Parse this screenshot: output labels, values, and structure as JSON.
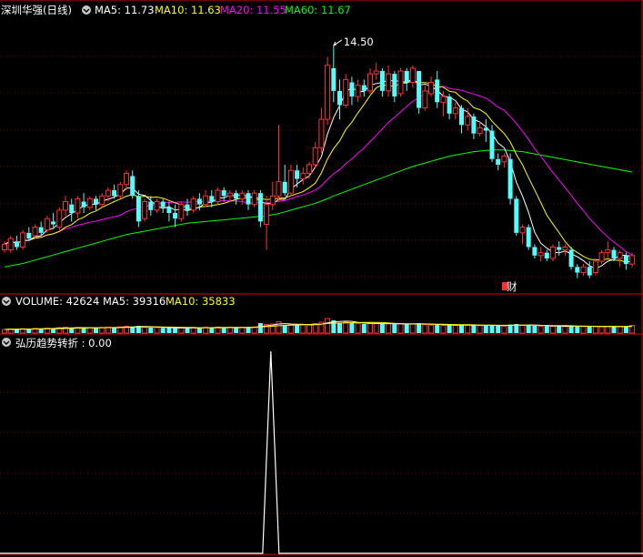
{
  "header": {
    "stock_title": "深圳华强(日线)",
    "ma_labels": [
      {
        "text": "MA5: 11.73",
        "color": "#ffffff"
      },
      {
        "text": "MA10: 11.63",
        "color": "#ffff00"
      },
      {
        "text": "MA20: 11.55",
        "color": "#ff00ff"
      },
      {
        "text": "MA60: 11.67",
        "color": "#00ff00"
      }
    ],
    "high_marker": "14.50",
    "finance_marker": "财"
  },
  "volume_header": [
    {
      "text": "VOLUME: 42624",
      "color": "#ffffff"
    },
    {
      "text": "MA5: 39316",
      "color": "#ffffff"
    },
    {
      "text": "MA10: 35833",
      "color": "#ffff00"
    }
  ],
  "indicator_header": {
    "text": "弘历趋势转折 : 0.00",
    "color": "#ffffff"
  },
  "colors": {
    "up": "#ff3232",
    "down": "#54ffff",
    "border": "#b00000",
    "grid": "#7a0000",
    "ma5": "#ffffff",
    "ma10": "#ffff00",
    "ma20": "#ff00ff",
    "ma60": "#00ff00"
  },
  "chart_data": {
    "type": "candlestick",
    "y_range": [
      10.3,
      14.9
    ],
    "max_price": 14.5,
    "candles": [
      [
        10.9,
        11.0,
        10.85,
        11.05
      ],
      [
        10.9,
        11.1,
        10.85,
        11.15
      ],
      [
        11.05,
        10.95,
        10.9,
        11.15
      ],
      [
        10.95,
        11.2,
        10.9,
        11.25
      ],
      [
        11.2,
        11.1,
        11.05,
        11.3
      ],
      [
        11.15,
        11.3,
        11.1,
        11.35
      ],
      [
        11.3,
        11.2,
        11.15,
        11.4
      ],
      [
        11.25,
        11.45,
        11.2,
        11.5
      ],
      [
        11.4,
        11.35,
        11.3,
        11.55
      ],
      [
        11.3,
        11.6,
        11.25,
        11.65
      ],
      [
        11.6,
        11.75,
        11.5,
        11.85
      ],
      [
        11.7,
        11.55,
        11.4,
        11.8
      ],
      [
        11.55,
        11.8,
        11.45,
        11.85
      ],
      [
        11.75,
        11.65,
        11.55,
        11.9
      ],
      [
        11.65,
        11.8,
        11.6,
        11.85
      ],
      [
        11.8,
        11.7,
        11.6,
        11.85
      ],
      [
        11.7,
        11.85,
        11.65,
        11.9
      ],
      [
        11.85,
        11.95,
        11.75,
        12.0
      ],
      [
        11.95,
        11.85,
        11.8,
        12.05
      ],
      [
        11.85,
        12.05,
        11.8,
        12.1
      ],
      [
        12.05,
        12.25,
        11.95,
        12.3
      ],
      [
        12.2,
        11.85,
        11.8,
        12.3
      ],
      [
        11.85,
        11.4,
        11.3,
        11.95
      ],
      [
        11.45,
        11.75,
        11.4,
        11.8
      ],
      [
        11.75,
        11.6,
        11.5,
        11.85
      ],
      [
        11.6,
        11.75,
        11.55,
        11.8
      ],
      [
        11.75,
        11.65,
        11.55,
        11.8
      ],
      [
        11.65,
        11.55,
        11.4,
        11.75
      ],
      [
        11.55,
        11.45,
        11.3,
        11.7
      ],
      [
        11.45,
        11.7,
        11.4,
        11.75
      ],
      [
        11.7,
        11.6,
        11.5,
        11.8
      ],
      [
        11.6,
        11.8,
        11.55,
        11.85
      ],
      [
        11.8,
        11.7,
        11.6,
        11.9
      ],
      [
        11.7,
        11.85,
        11.65,
        11.95
      ],
      [
        11.85,
        11.75,
        11.65,
        11.95
      ],
      [
        11.75,
        11.95,
        11.7,
        12.0
      ],
      [
        11.95,
        11.85,
        11.75,
        12.0
      ],
      [
        11.85,
        11.9,
        11.75,
        11.95
      ],
      [
        11.9,
        11.8,
        11.7,
        11.95
      ],
      [
        11.8,
        11.9,
        11.7,
        11.95
      ],
      [
        11.9,
        11.7,
        11.6,
        11.95
      ],
      [
        11.7,
        11.9,
        11.65,
        11.95
      ],
      [
        11.9,
        11.4,
        11.3,
        11.95
      ],
      [
        11.35,
        11.7,
        10.9,
        11.85
      ],
      [
        11.7,
        11.85,
        11.6,
        12.1
      ],
      [
        11.85,
        12.1,
        11.75,
        13.1
      ],
      [
        12.1,
        11.9,
        11.85,
        12.4
      ],
      [
        11.9,
        12.3,
        11.85,
        12.4
      ],
      [
        12.3,
        12.15,
        12.0,
        12.4
      ],
      [
        12.15,
        12.25,
        12.05,
        12.35
      ],
      [
        12.25,
        12.4,
        12.15,
        12.45
      ],
      [
        12.4,
        12.7,
        12.35,
        12.8
      ],
      [
        12.7,
        13.2,
        12.6,
        13.4
      ],
      [
        13.2,
        14.15,
        13.1,
        14.3
      ],
      [
        14.1,
        13.7,
        13.5,
        14.5
      ],
      [
        13.7,
        13.45,
        13.2,
        13.9
      ],
      [
        13.45,
        13.9,
        13.4,
        14.0
      ],
      [
        13.85,
        13.6,
        13.45,
        13.95
      ],
      [
        13.6,
        13.8,
        13.5,
        13.9
      ],
      [
        13.8,
        13.7,
        13.6,
        13.9
      ],
      [
        13.7,
        14.0,
        13.65,
        14.1
      ],
      [
        14.0,
        14.05,
        13.9,
        14.2
      ],
      [
        14.05,
        13.7,
        13.6,
        14.1
      ],
      [
        13.7,
        14.0,
        13.6,
        14.15
      ],
      [
        14.0,
        13.6,
        13.5,
        14.05
      ],
      [
        13.65,
        14.05,
        13.6,
        14.1
      ],
      [
        14.05,
        13.85,
        13.7,
        14.1
      ],
      [
        13.85,
        14.1,
        13.75,
        14.15
      ],
      [
        14.05,
        13.4,
        13.3,
        14.05
      ],
      [
        13.4,
        13.7,
        13.35,
        13.8
      ],
      [
        13.65,
        13.85,
        13.6,
        13.95
      ],
      [
        13.9,
        13.5,
        13.4,
        14.05
      ],
      [
        13.5,
        13.6,
        13.25,
        13.7
      ],
      [
        13.6,
        13.3,
        13.2,
        13.65
      ],
      [
        13.3,
        13.4,
        13.2,
        13.5
      ],
      [
        13.4,
        13.1,
        12.95,
        13.45
      ],
      [
        13.1,
        13.25,
        13.0,
        13.4
      ],
      [
        13.25,
        12.95,
        12.85,
        13.3
      ],
      [
        12.95,
        13.05,
        12.9,
        13.15
      ],
      [
        13.05,
        13.0,
        12.8,
        13.2
      ],
      [
        13.0,
        12.5,
        12.45,
        13.1
      ],
      [
        12.5,
        12.4,
        12.3,
        12.6
      ],
      [
        12.45,
        12.55,
        12.35,
        12.6
      ],
      [
        12.5,
        11.8,
        11.7,
        12.6
      ],
      [
        11.8,
        11.2,
        11.15,
        11.85
      ],
      [
        11.2,
        11.3,
        11.0,
        11.35
      ],
      [
        11.3,
        10.95,
        10.9,
        11.35
      ],
      [
        10.95,
        10.8,
        10.75,
        11.0
      ],
      [
        10.8,
        10.85,
        10.7,
        10.95
      ],
      [
        10.85,
        10.75,
        10.7,
        10.9
      ],
      [
        10.75,
        10.95,
        10.7,
        11.0
      ],
      [
        10.95,
        10.9,
        10.8,
        11.05
      ],
      [
        10.9,
        10.95,
        10.8,
        11.0
      ],
      [
        10.9,
        10.6,
        10.55,
        10.95
      ],
      [
        10.6,
        10.5,
        10.4,
        10.65
      ],
      [
        10.5,
        10.6,
        10.45,
        10.65
      ],
      [
        10.6,
        10.45,
        10.4,
        10.7
      ],
      [
        10.5,
        10.7,
        10.45,
        10.75
      ],
      [
        10.7,
        10.85,
        10.65,
        10.9
      ],
      [
        10.85,
        10.9,
        10.75,
        11.05
      ],
      [
        10.9,
        10.75,
        10.7,
        10.95
      ],
      [
        10.75,
        10.85,
        10.6,
        10.9
      ],
      [
        10.8,
        10.65,
        10.55,
        10.85
      ],
      [
        10.65,
        10.8,
        10.6,
        10.85
      ]
    ],
    "ma60": [
      10.6,
      10.62,
      10.64,
      10.66,
      10.69,
      10.72,
      10.75,
      10.78,
      10.81,
      10.84,
      10.87,
      10.9,
      10.93,
      10.96,
      10.99,
      11.02,
      11.05,
      11.08,
      11.11,
      11.14,
      11.17,
      11.19,
      11.21,
      11.23,
      11.25,
      11.27,
      11.29,
      11.31,
      11.33,
      11.35,
      11.37,
      11.38,
      11.39,
      11.4,
      11.41,
      11.42,
      11.43,
      11.44,
      11.45,
      11.46,
      11.47,
      11.48,
      11.49,
      11.5,
      11.52,
      11.54,
      11.57,
      11.6,
      11.63,
      11.66,
      11.69,
      11.72,
      11.76,
      11.8,
      11.85,
      11.89,
      11.93,
      11.97,
      12.01,
      12.05,
      12.09,
      12.13,
      12.17,
      12.21,
      12.25,
      12.29,
      12.33,
      12.37,
      12.4,
      12.43,
      12.46,
      12.49,
      12.52,
      12.55,
      12.57,
      12.59,
      12.61,
      12.63,
      12.64,
      12.65,
      12.66,
      12.66,
      12.66,
      12.65,
      12.64,
      12.63,
      12.61,
      12.59,
      12.57,
      12.55,
      12.53,
      12.51,
      12.49,
      12.47,
      12.45,
      12.43,
      12.41,
      12.39,
      12.37,
      12.35,
      12.33,
      12.31,
      12.29,
      12.27
    ],
    "volume": {
      "range": [
        0,
        120000
      ],
      "values": [
        20000,
        22000,
        21000,
        24000,
        23000,
        26000,
        25000,
        27000,
        26000,
        30000,
        32000,
        29000,
        31000,
        28000,
        30000,
        29000,
        31000,
        33000,
        30000,
        34000,
        38000,
        36000,
        40000,
        33000,
        30000,
        31000,
        29000,
        28000,
        27000,
        30000,
        29000,
        31000,
        28000,
        32000,
        30000,
        33000,
        31000,
        32000,
        30000,
        31000,
        33000,
        34000,
        55000,
        48000,
        50000,
        62000,
        44000,
        47000,
        43000,
        45000,
        46000,
        52000,
        60000,
        80000,
        70000,
        58000,
        60000,
        55000,
        52000,
        50000,
        53000,
        54000,
        50000,
        52000,
        49000,
        51000,
        48000,
        50000,
        54000,
        46000,
        44000,
        47000,
        42000,
        45000,
        43000,
        46000,
        44000,
        43000,
        41000,
        42000,
        45000,
        40000,
        39000,
        47000,
        50000,
        42000,
        44000,
        40000,
        38000,
        39000,
        37000,
        38000,
        36000,
        40000,
        38000,
        36000,
        37000,
        35000,
        36000,
        37000,
        35000,
        36000,
        35000,
        42624
      ]
    },
    "indicator": {
      "range": [
        0,
        1
      ],
      "spike_index": 44,
      "spike_value": 1,
      "current": 0.0
    }
  }
}
